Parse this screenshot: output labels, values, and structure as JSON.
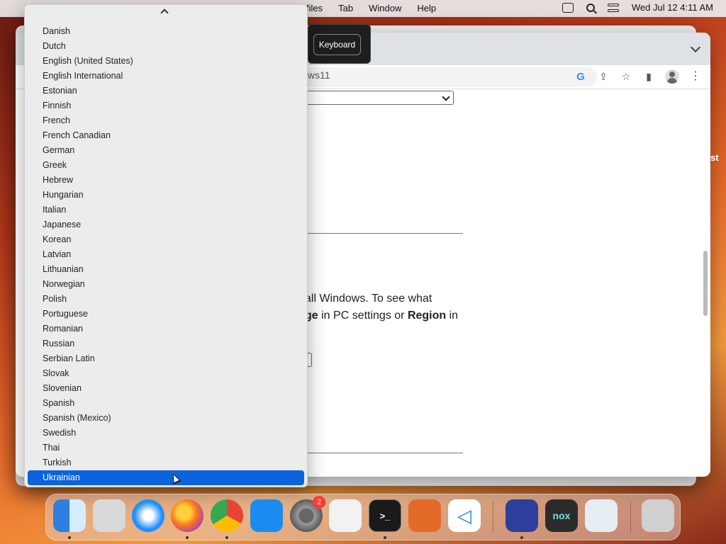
{
  "menubar": {
    "items": [
      "files",
      "Tab",
      "Window",
      "Help"
    ],
    "datetime": "Wed Jul 12  4:11 AM"
  },
  "browser": {
    "url_fragment": "ws11",
    "tooltip_label": "Keyboard",
    "content": {
      "paragraph_line1": "all Windows. To see what",
      "paragraph_bold1": "ge",
      "paragraph_mid": " in PC settings or ",
      "paragraph_bold2": "Region",
      "paragraph_end": " in"
    }
  },
  "edge_text": "st",
  "dropdown": {
    "items": [
      "Danish",
      "Dutch",
      "English (United States)",
      "English International",
      "Estonian",
      "Finnish",
      "French",
      "French Canadian",
      "German",
      "Greek",
      "Hebrew",
      "Hungarian",
      "Italian",
      "Japanese",
      "Korean",
      "Latvian",
      "Lithuanian",
      "Norwegian",
      "Polish",
      "Portuguese",
      "Romanian",
      "Russian",
      "Serbian Latin",
      "Slovak",
      "Slovenian",
      "Spanish",
      "Spanish (Mexico)",
      "Swedish",
      "Thai",
      "Turkish",
      "Ukrainian"
    ],
    "selected": "Ukrainian"
  },
  "dock": {
    "apps": [
      {
        "name": "finder-icon",
        "color": "#3a8ee6",
        "running": true
      },
      {
        "name": "launchpad-icon",
        "color": "#d9d9d9",
        "running": false
      },
      {
        "name": "safari-icon",
        "color": "#1e90ff",
        "running": false
      },
      {
        "name": "firefox-icon",
        "color": "#ff7a1a",
        "running": true
      },
      {
        "name": "chrome-icon",
        "color": "#e9e9e9",
        "running": true
      },
      {
        "name": "app-store-icon",
        "color": "#1c8bf0",
        "running": false
      },
      {
        "name": "system-settings-icon",
        "color": "#8a8a8a",
        "running": false,
        "badge": "2"
      },
      {
        "name": "textedit-icon",
        "color": "#f2f2f2",
        "running": false
      },
      {
        "name": "terminal-icon",
        "color": "#1a1a1a",
        "running": true
      },
      {
        "name": "garageband-icon",
        "color": "#e46a2a",
        "running": false
      },
      {
        "name": "vscode-icon",
        "color": "#ffffff",
        "running": false
      },
      {
        "name": "remote-desktop-icon",
        "color": "#2d3e9c",
        "running": true
      },
      {
        "name": "nox-icon",
        "color": "#2b2b2b",
        "running": false
      },
      {
        "name": "preview-icon",
        "color": "#e6edf3",
        "running": false
      },
      {
        "name": "trash-icon",
        "color": "#d0d0d0",
        "running": false
      }
    ]
  }
}
